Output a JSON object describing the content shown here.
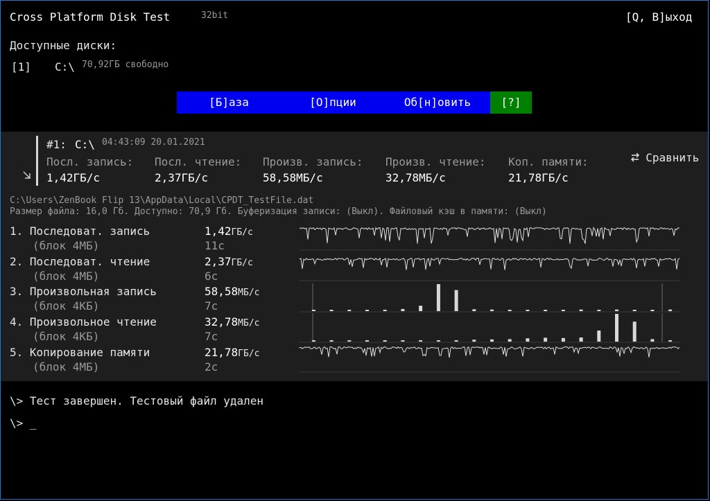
{
  "app": {
    "title": "Cross Platform Disk Test",
    "arch": "32bit",
    "exit": "[Q, В]ыход"
  },
  "drives": {
    "heading": "Доступные диски:",
    "items": [
      {
        "key": "[1]",
        "name": "C:\\",
        "free": "70,92ГБ свободно"
      }
    ]
  },
  "menu": {
    "items": [
      {
        "label": "[Б]аза",
        "color": "#0000f0"
      },
      {
        "label": "[О]пции",
        "color": "#0000f0"
      },
      {
        "label": "Об[н]овить",
        "color": "#0000f0"
      },
      {
        "label": "[?]",
        "color": "#008000"
      }
    ]
  },
  "summary": {
    "run": "#1:",
    "drive": "C:\\",
    "datetime": "04:43:09 20.01.2021",
    "compare": "Сравнить",
    "compare_icon": "swap-arrows-icon",
    "expand_icon": "corner-arrow-icon",
    "columns": [
      {
        "label": "Посл. запись:",
        "value": "1,42ГБ/с"
      },
      {
        "label": "Посл. чтение:",
        "value": "2,37ГБ/с"
      },
      {
        "label": "Произв. запись:",
        "value": "58,58МБ/с"
      },
      {
        "label": "Произв. чтение:",
        "value": "32,78МБ/с"
      },
      {
        "label": "Коп. памяти:",
        "value": "21,78ГБ/с"
      }
    ]
  },
  "file": {
    "path": "C:\\Users\\ZenBook Flip 13\\AppData\\Local\\CPDT_TestFile.dat",
    "info": "Размер файла: 16,0 Гб. Доступно: 70,9 Гб. Буферизация записи: (Выкл). Файловый кэш в памяти: (Выкл)"
  },
  "tests": [
    {
      "name": "1. Последоват. запись",
      "block": "(блок 4МБ)",
      "value": "1,42",
      "unit": "ГБ/с",
      "time": "11с"
    },
    {
      "name": "2. Последоват. чтение",
      "block": "(блок 4МБ)",
      "value": "2,37",
      "unit": "ГБ/с",
      "time": "6с"
    },
    {
      "name": "3. Произвольная запись",
      "block": "(блок 4КБ)",
      "value": "58,58",
      "unit": "МБ/с",
      "time": "7с"
    },
    {
      "name": "4. Произвольное чтение",
      "block": "(блок 4КБ)",
      "value": "32,78",
      "unit": "МБ/с",
      "time": "7с"
    },
    {
      "name": "5. Копирование памяти",
      "block": "(блок 4МБ)",
      "value": "21,78",
      "unit": "ГБ/с",
      "time": "2с"
    }
  ],
  "charts": {
    "random_write_bars": [
      0.05,
      0.05,
      0.05,
      0.05,
      0.05,
      0.08,
      0.2,
      1.0,
      0.78,
      0.07,
      0.06,
      0.05,
      0.05,
      0.05,
      0.05,
      0.06,
      0.05,
      0.06,
      0.05,
      0.05,
      0.06
    ],
    "random_read_bars": [
      0.05,
      0.05,
      0.05,
      0.05,
      0.05,
      0.05,
      0.05,
      0.05,
      0.05,
      0.07,
      0.08,
      0.09,
      0.12,
      0.14,
      0.13,
      0.15,
      0.4,
      1.0,
      0.72,
      0.09,
      0.05
    ]
  },
  "console": {
    "lines": [
      "\\> Тест завершен. Тестовый файл удален",
      "\\> _"
    ]
  }
}
